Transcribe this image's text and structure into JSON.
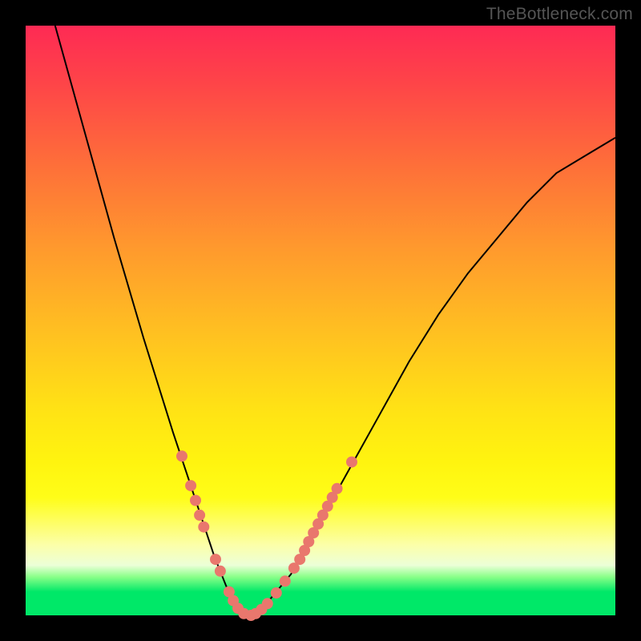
{
  "watermark": "TheBottleneck.com",
  "chart_data": {
    "type": "line",
    "title": "",
    "xlabel": "",
    "ylabel": "",
    "ylim": [
      0,
      100
    ],
    "xlim": [
      0,
      100
    ],
    "series": [
      {
        "name": "bottleneck-curve",
        "x": [
          5,
          10,
          15,
          20,
          25,
          28,
          30,
          32,
          34,
          36,
          37,
          38,
          40,
          45,
          50,
          55,
          60,
          65,
          70,
          75,
          80,
          85,
          90,
          95,
          100
        ],
        "y": [
          100,
          82,
          64,
          47,
          31,
          22,
          16,
          10,
          5,
          1,
          0,
          0,
          1,
          7,
          16,
          25,
          34,
          43,
          51,
          58,
          64,
          70,
          75,
          78,
          81
        ]
      }
    ],
    "markers": {
      "name": "highlighted-points",
      "color": "#e9776d",
      "points": [
        {
          "x": 26.5,
          "y": 27
        },
        {
          "x": 28.0,
          "y": 22
        },
        {
          "x": 28.8,
          "y": 19.5
        },
        {
          "x": 29.5,
          "y": 17
        },
        {
          "x": 30.2,
          "y": 15
        },
        {
          "x": 32.2,
          "y": 9.5
        },
        {
          "x": 33.0,
          "y": 7.5
        },
        {
          "x": 34.5,
          "y": 4
        },
        {
          "x": 35.2,
          "y": 2.5
        },
        {
          "x": 36.0,
          "y": 1.2
        },
        {
          "x": 37.0,
          "y": 0.3
        },
        {
          "x": 38.2,
          "y": 0
        },
        {
          "x": 39.0,
          "y": 0.3
        },
        {
          "x": 40.0,
          "y": 1
        },
        {
          "x": 41.0,
          "y": 2
        },
        {
          "x": 42.5,
          "y": 3.8
        },
        {
          "x": 44.0,
          "y": 5.8
        },
        {
          "x": 45.5,
          "y": 8
        },
        {
          "x": 46.5,
          "y": 9.5
        },
        {
          "x": 47.3,
          "y": 11
        },
        {
          "x": 48.0,
          "y": 12.5
        },
        {
          "x": 48.8,
          "y": 14
        },
        {
          "x": 49.6,
          "y": 15.5
        },
        {
          "x": 50.4,
          "y": 17
        },
        {
          "x": 51.2,
          "y": 18.5
        },
        {
          "x": 52.0,
          "y": 20
        },
        {
          "x": 52.8,
          "y": 21.5
        },
        {
          "x": 55.3,
          "y": 26
        }
      ]
    },
    "gradient_stops": [
      {
        "pos": 0,
        "color": "#fe2a54"
      },
      {
        "pos": 50,
        "color": "#ffc021"
      },
      {
        "pos": 80,
        "color": "#fffd18"
      },
      {
        "pos": 96,
        "color": "#00e868"
      }
    ]
  }
}
